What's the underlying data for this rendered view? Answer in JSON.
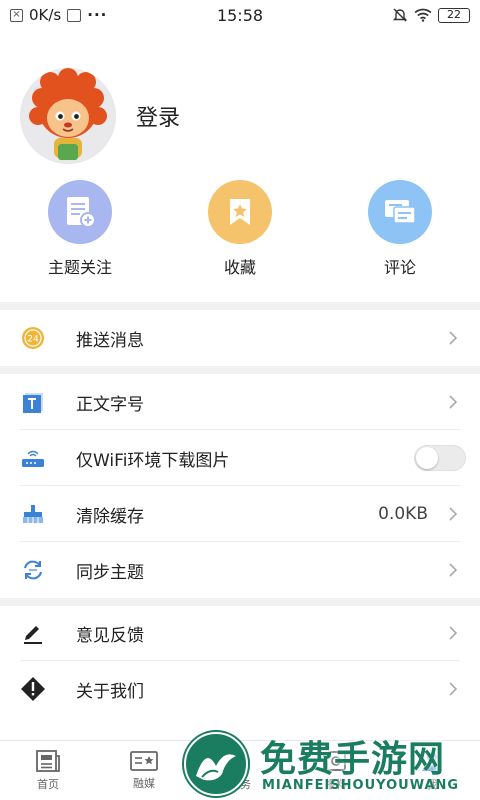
{
  "status_bar": {
    "network_speed": "0K/s",
    "dots": "···",
    "time": "15:58",
    "battery": "22"
  },
  "profile": {
    "login_label": "登录"
  },
  "quick_actions": [
    {
      "label": "主题关注",
      "icon": "topic-follow-icon",
      "color": "#9fb0ee"
    },
    {
      "label": "收藏",
      "icon": "bookmark-icon",
      "color": "#f5c36b"
    },
    {
      "label": "评论",
      "icon": "comment-icon",
      "color": "#8ec4f5"
    }
  ],
  "menu": {
    "push": {
      "label": "推送消息",
      "badge": "24"
    },
    "font_size": {
      "label": "正文字号"
    },
    "wifi_only": {
      "label": "仅WiFi环境下载图片",
      "enabled": false
    },
    "clear_cache": {
      "label": "清除缓存",
      "value": "0.0KB"
    },
    "sync_topics": {
      "label": "同步主题"
    },
    "feedback": {
      "label": "意见反馈"
    },
    "about": {
      "label": "关于我们"
    }
  },
  "bottom_nav": [
    {
      "label": "首页",
      "icon": "home-news-icon"
    },
    {
      "label": "融媒",
      "icon": "media-card-icon"
    },
    {
      "label": "服务",
      "icon": "service-icon"
    },
    {
      "label": "报料",
      "icon": "report-icon"
    },
    {
      "label": "我",
      "icon": "me-icon"
    }
  ],
  "watermark": {
    "title": "免费手游网",
    "subtitle": "MIANFEISHOUYOUWANG"
  },
  "colors": {
    "accent_green": "#1b7d5f",
    "push_badge": "#f0b535",
    "font_icon": "#3b82d6"
  }
}
